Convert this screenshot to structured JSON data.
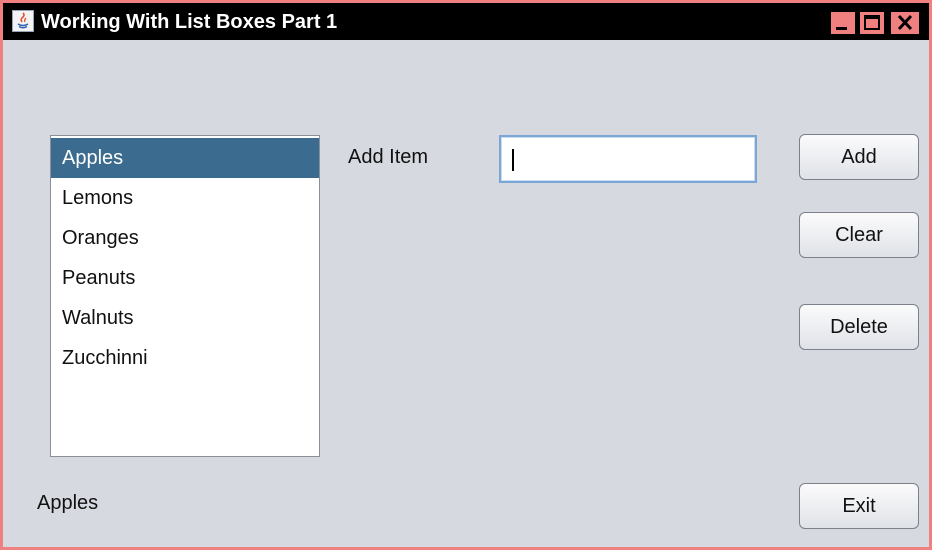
{
  "window": {
    "title": "Working With List Boxes Part 1",
    "colors": {
      "border": "#f08080",
      "titlebar": "#000000",
      "background": "#d6d9df",
      "selection": "#3b6b8e"
    }
  },
  "list": {
    "items": [
      "Apples",
      "Lemons",
      "Oranges",
      "Peanuts",
      "Walnuts",
      "Zucchinni"
    ],
    "selected_index": 0
  },
  "add_item": {
    "label": "Add Item",
    "value": ""
  },
  "buttons": {
    "add": "Add",
    "clear": "Clear",
    "delete": "Delete",
    "exit": "Exit"
  },
  "status": {
    "selected_text": "Apples"
  }
}
